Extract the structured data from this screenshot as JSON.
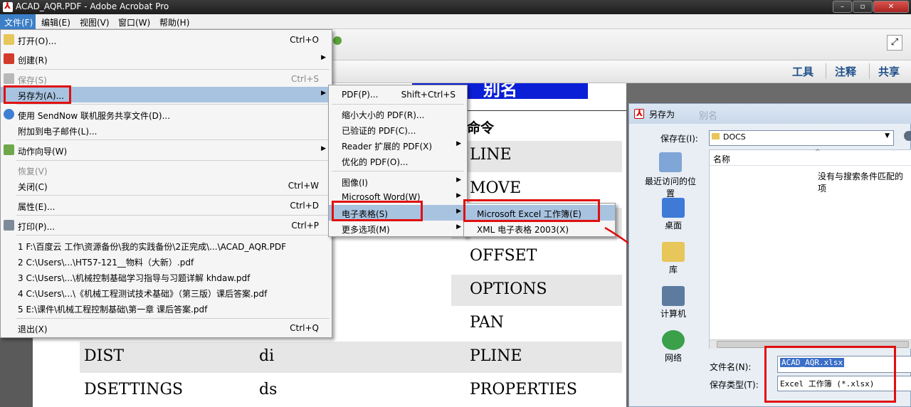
{
  "window": {
    "title": "ACAD_AQR.PDF - Adobe Acrobat Pro",
    "min": "–",
    "max": "▫",
    "close": "✕"
  },
  "menubar": [
    "文件(F)",
    "编辑(E)",
    "视图(V)",
    "窗口(W)",
    "帮助(H)"
  ],
  "toolbar": {
    "tools": "工具",
    "comment": "注释",
    "share": "共享"
  },
  "file_menu": {
    "open": "打开(O)...",
    "open_sc": "Ctrl+O",
    "create": "创建(R)",
    "save": "保存(S)",
    "save_sc": "Ctrl+S",
    "saveas": "另存为(A)...",
    "sendnow": "使用 SendNow 联机服务共享文件(D)...",
    "attach": "附加到电子邮件(L)...",
    "wizard": "动作向导(W)",
    "revert": "恢复(V)",
    "close": "关闭(C)",
    "close_sc": "Ctrl+W",
    "props": "属性(E)...",
    "props_sc": "Ctrl+D",
    "print": "打印(P)...",
    "print_sc": "Ctrl+P",
    "recent": [
      "1 F:\\百度云 工作\\资源备份\\我的实践备份\\2正完成\\...\\ACAD_AQR.PDF",
      "2 C:\\Users\\...\\HT57-121__物料（大新）.pdf",
      "3 C:\\Users\\...\\机械控制基础学习指导与习题详解 khdaw.pdf",
      "4 C:\\Users\\...\\《机械工程测试技术基础》（第三版）课后答案.pdf",
      "5 E:\\课件\\机械工程控制基础\\第一章 课后答案.pdf"
    ],
    "exit": "退出(X)",
    "exit_sc": "Ctrl+Q"
  },
  "saveas_menu": {
    "pdf": "PDF(P)...",
    "pdf_sc": "Shift+Ctrl+S",
    "reduced": "缩小大小的 PDF(R)...",
    "certified": "已验证的 PDF(C)...",
    "reader": "Reader 扩展的 PDF(X)",
    "optimized": "优化的 PDF(O)...",
    "image": "图像(I)",
    "word": "Microsoft Word(W)",
    "spreadsheet": "电子表格(S)",
    "more": "更多选项(M)"
  },
  "sheet_menu": {
    "excel": "Microsoft Excel 工作簿(E)",
    "xml": "XML 电子表格 2003(X)"
  },
  "doc": {
    "heading": "命令",
    "banner": "别名",
    "col3": [
      "LINE",
      "MOVE",
      "OFFSET",
      "OPTIONS",
      "PAN",
      "PLINE",
      "PROPERTIES"
    ],
    "row_dist": {
      "name": "DIST",
      "alias": "di"
    },
    "row_dset": {
      "name": "DSETTINGS",
      "alias": "ds"
    }
  },
  "dialog": {
    "title": "另存为",
    "title_ghost": "别名",
    "savein_label": "保存在(I):",
    "savein_value": "DOCS",
    "col_name": "名称",
    "empty_msg": "没有与搜索条件匹配的项",
    "places": [
      "最近访问的位置",
      "桌面",
      "库",
      "计算机",
      "网络"
    ],
    "filename_label": "文件名(N):",
    "filename_value": "ACAD_AQR.xlsx",
    "filetype_label": "保存类型(T):",
    "filetype_value": "Excel 工作簿 (*.xlsx)"
  },
  "colors": {
    "highlight": "#a8c3e0",
    "annotation": "#e01010",
    "banner": "#0b1fd6"
  }
}
